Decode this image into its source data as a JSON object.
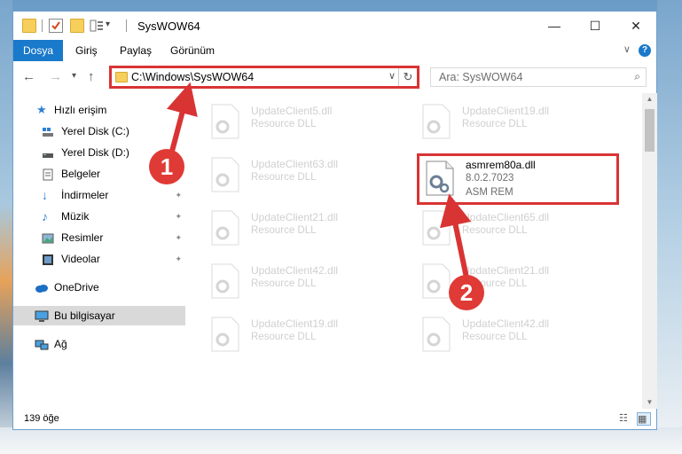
{
  "window": {
    "title": "SysWOW64",
    "minimize_glyph": "—",
    "maximize_glyph": "☐",
    "close_glyph": "✕",
    "qa_dropdown_glyph": "▾"
  },
  "ribbon": {
    "tabs": [
      "Dosya",
      "Giriş",
      "Paylaş",
      "Görünüm"
    ],
    "expand_glyph": "∨",
    "help_glyph": "?"
  },
  "navbar": {
    "back_glyph": "←",
    "forward_glyph": "→",
    "history_glyph": "▾",
    "up_glyph": "↑",
    "address": "C:\\Windows\\SysWOW64",
    "address_dropdown_glyph": "∨",
    "refresh_glyph": "↻",
    "search_placeholder": "Ara: SysWOW64",
    "search_icon_glyph": "⌕"
  },
  "sidebar": {
    "items": [
      {
        "label": "Hızlı erişim",
        "icon": "star-icon",
        "pinned": false
      },
      {
        "label": "Yerel Disk (C:)",
        "icon": "drive-icon",
        "pinned": false
      },
      {
        "label": "Yerel Disk (D:)",
        "icon": "drive-icon",
        "pinned": false
      },
      {
        "label": "Belgeler",
        "icon": "documents-icon",
        "pinned": false
      },
      {
        "label": "İndirmeler",
        "icon": "download-icon",
        "pinned": true
      },
      {
        "label": "Müzik",
        "icon": "music-icon",
        "pinned": true
      },
      {
        "label": "Resimler",
        "icon": "pictures-icon",
        "pinned": true
      },
      {
        "label": "Videolar",
        "icon": "video-icon",
        "pinned": true
      },
      {
        "label": "OneDrive",
        "icon": "cloud-icon",
        "pinned": false
      },
      {
        "label": "Bu bilgisayar",
        "icon": "computer-icon",
        "pinned": false,
        "selected": true
      },
      {
        "label": "Ağ",
        "icon": "network-icon",
        "pinned": false
      }
    ],
    "pin_glyph": "📌"
  },
  "files": {
    "left_column": [
      {
        "name": "UpdateClient5.dll",
        "type": "Resource DLL"
      },
      {
        "name": "UpdateClient63.dll",
        "type": "Resource DLL"
      },
      {
        "name": "UpdateClient21.dll",
        "type": "Resource DLL"
      },
      {
        "name": "UpdateClient42.dll",
        "type": "Resource DLL"
      },
      {
        "name": "UpdateClient19.dll",
        "type": "Resource DLL"
      }
    ],
    "right_column": [
      {
        "name": "UpdateClient19.dll",
        "type": "Resource DLL"
      },
      {
        "name": "asmrem80a.dll",
        "version": "8.0.2.7023",
        "type": "ASM REM",
        "highlighted": true
      },
      {
        "name": "UpdateClient65.dll",
        "type": "Resource DLL"
      },
      {
        "name": "UpdateClient21.dll",
        "type": "Resource DLL"
      },
      {
        "name": "UpdateClient42.dll",
        "type": "Resource DLL"
      }
    ]
  },
  "status": {
    "item_count": "139 öğe"
  },
  "annotations": {
    "step1": "1",
    "step2": "2",
    "color": "#d93434"
  }
}
